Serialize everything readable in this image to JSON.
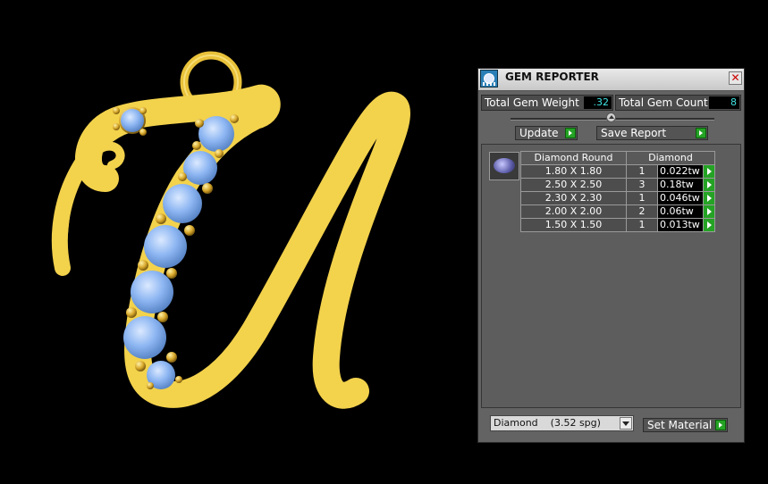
{
  "panel": {
    "title": "GEM REPORTER",
    "total_gem_weight_label": "Total Gem Weight",
    "total_gem_weight_value": ".32",
    "total_gem_count_label": "Total Gem Count",
    "total_gem_count_value": "8",
    "update_label": "Update",
    "save_report_label": "Save Report",
    "table": {
      "headers": [
        "Diamond Round",
        "Diamond"
      ],
      "rows": [
        {
          "size": "1.80 X 1.80",
          "count": "1",
          "weight": "0.022tw"
        },
        {
          "size": "2.50 X 2.50",
          "count": "3",
          "weight": "0.18tw"
        },
        {
          "size": "2.30 X 2.30",
          "count": "1",
          "weight": "0.046tw"
        },
        {
          "size": "2.00 X 2.00",
          "count": "2",
          "weight": "0.06tw"
        },
        {
          "size": "1.50 X 1.50",
          "count": "1",
          "weight": "0.013tw"
        }
      ]
    },
    "material_select": {
      "material": "Diamond",
      "sg": "(3.52 spg)"
    },
    "set_material_label": "Set Material",
    "colors": {
      "accent_go": "#25a325",
      "value_text": "#3fe3e3",
      "panel_bg": "#636363"
    }
  },
  "viewport": {
    "subject": "gold letter U pendant with blue gemstones",
    "metal_color": "#f3d24c",
    "gem_color": "#8db6f2"
  }
}
